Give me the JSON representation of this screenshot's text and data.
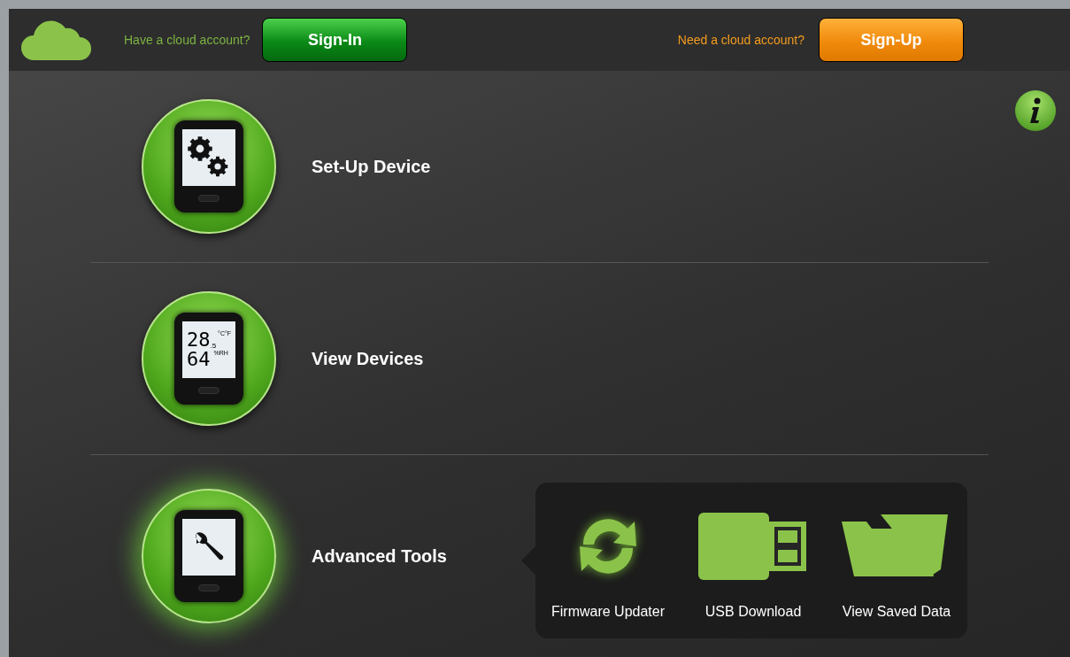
{
  "top_bar": {
    "signin_prompt": "Have a cloud account?",
    "signin_button": "Sign-In",
    "signup_prompt": "Need a cloud account?",
    "signup_button": "Sign-Up"
  },
  "menu": [
    {
      "kind": "setup",
      "label": "Set-Up Device",
      "selected": false
    },
    {
      "kind": "view",
      "label": "View Devices",
      "selected": false,
      "display": {
        "temp": "28",
        "decimal": ".5",
        "temp_unit": "°C°F",
        "humidity": "64",
        "humidity_unit": "%RH"
      }
    },
    {
      "kind": "tools",
      "label": "Advanced Tools",
      "selected": true
    }
  ],
  "tools_popup": [
    {
      "kind": "firmware",
      "label": "Firmware Updater"
    },
    {
      "kind": "usb",
      "label": "USB Download"
    },
    {
      "kind": "folder",
      "label": "View Saved Data"
    }
  ]
}
